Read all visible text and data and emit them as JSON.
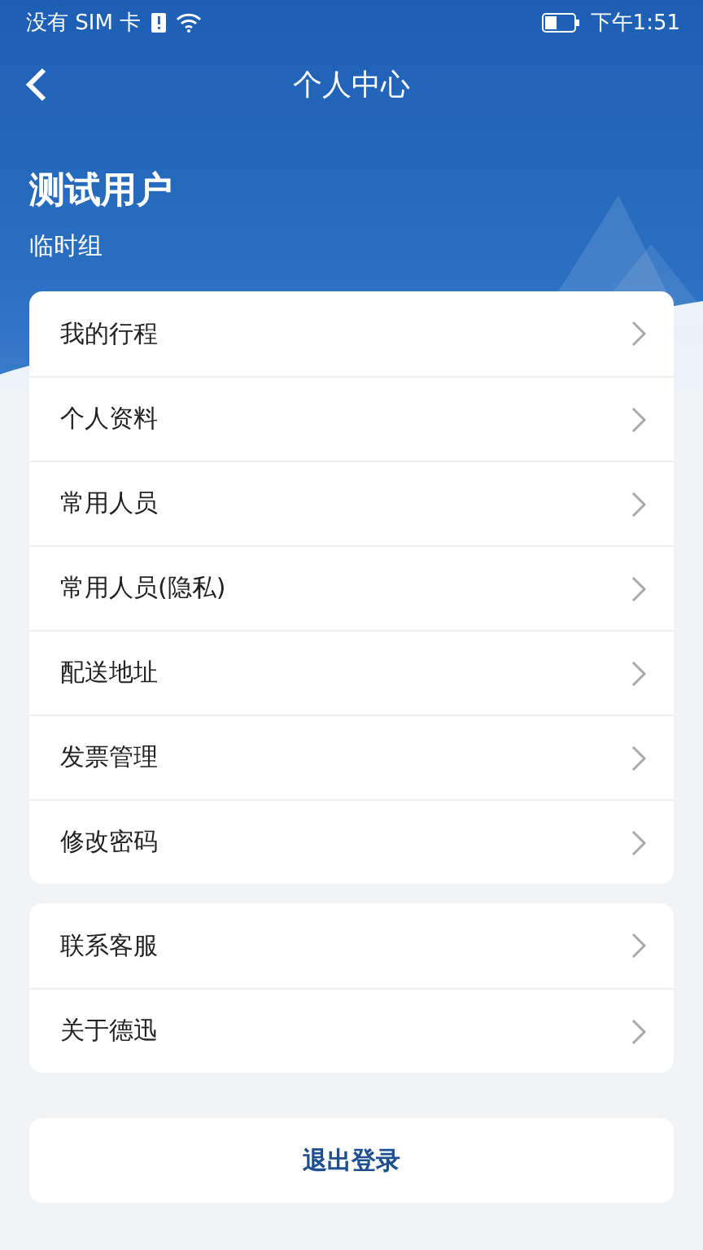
{
  "status_bar": {
    "carrier": "没有 SIM 卡",
    "time": "下午1:51"
  },
  "header": {
    "title": "个人中心"
  },
  "profile": {
    "name": "测试用户",
    "group": "临时组"
  },
  "menu_groups": [
    {
      "items": [
        {
          "label": "我的行程"
        },
        {
          "label": "个人资料"
        },
        {
          "label": "常用人员"
        },
        {
          "label": "常用人员(隐私)"
        },
        {
          "label": "配送地址"
        },
        {
          "label": "发票管理"
        },
        {
          "label": "修改密码"
        }
      ]
    },
    {
      "items": [
        {
          "label": "联系客服"
        },
        {
          "label": "关于德迅"
        }
      ]
    }
  ],
  "logout_button": "退出登录"
}
